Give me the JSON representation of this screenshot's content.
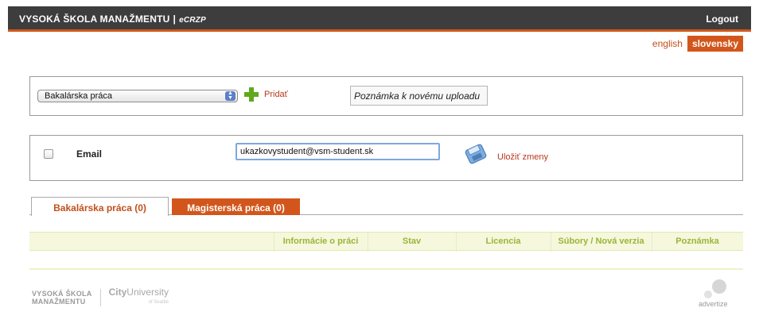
{
  "header": {
    "brand": "VYSOKÁ ŠKOLA MANAŽMENTU",
    "separator": "|",
    "subtitle": "eCRZP",
    "logout": "Logout"
  },
  "language": {
    "english": "english",
    "slovak": "slovensky"
  },
  "upload_panel": {
    "type_select_value": "Bakalárska práca",
    "add_label": "Pridať",
    "note_button": "Poznámka k novému uploadu"
  },
  "email_panel": {
    "label": "Email",
    "value": "ukazkovystudent@vsm-student.sk",
    "save_label": "Uložiť zmeny"
  },
  "tabs": [
    {
      "label": "Bakalárska práca (0)",
      "active": true
    },
    {
      "label": "Magisterská práca (0)",
      "active": false
    }
  ],
  "table": {
    "columns": [
      "Informácie o práci",
      "Stav",
      "Licencia",
      "Súbory / Nová verzia",
      "Poznámka"
    ]
  },
  "footer": {
    "logo_line1": "VYSOKÁ ŠKOLA",
    "logo_line2": "MANAŽMENTU",
    "city_bold": "City",
    "city_thin": "University",
    "city_sub": "of Seattle",
    "advertize": "advertize"
  },
  "colors": {
    "accent": "#d2561b",
    "header_bg": "#3d3d3d",
    "link": "#b8371a",
    "table_header_bg": "#f5f8dc",
    "table_header_text": "#9cb43a"
  }
}
